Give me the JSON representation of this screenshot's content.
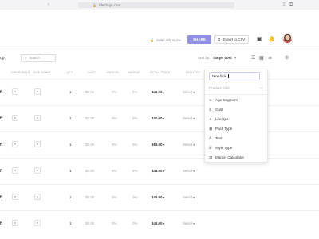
{
  "browser": {
    "url": "lifestage.com",
    "back_icon": "chevron-left-icon",
    "share_icon": "share-icon",
    "tabs_icon": "tabs-icon"
  },
  "appbar": {
    "invite_text": "Invite only to me",
    "share_label": "SHARE",
    "export_label": "Export to CSV",
    "icons": [
      "lock-icon",
      "chat-icon",
      "bell-icon"
    ],
    "colors": {
      "share_bg": "#8f8fe6"
    }
  },
  "toolbar": {
    "left_label": "op",
    "search_placeholder": "Search",
    "sort_label": "Sort by:",
    "sort_value": "Target cost",
    "view_icons": [
      "list-icon",
      "grid-icon",
      "columns-icon"
    ],
    "settings_icon": "gear-icon"
  },
  "columns": [
    "Colorways",
    "Size scale",
    "QTY",
    "Cost",
    "Margin",
    "Markup",
    "Retail price",
    "Delivery"
  ],
  "rows": [
    {
      "product": "ft",
      "qty": "1",
      "cost": "$0.00",
      "margin": "0%",
      "markup": "0%",
      "retail": "$48.00",
      "delivery": "Select"
    },
    {
      "product": "ft",
      "qty": "1",
      "cost": "$0.00",
      "margin": "0%",
      "markup": "0%",
      "retail": "$30.00",
      "delivery": "Select"
    },
    {
      "product": "ft",
      "qty": "1",
      "cost": "$0.00",
      "margin": "0%",
      "markup": "0%",
      "retail": "$68.00",
      "delivery": "Select"
    },
    {
      "product": "ft",
      "qty": "1",
      "cost": "$0.00",
      "margin": "0%",
      "markup": "0%",
      "retail": "$48.00",
      "delivery": "Select"
    },
    {
      "product": "ft",
      "qty": "1",
      "cost": "$0.00",
      "margin": "0%",
      "markup": "0%",
      "retail": "$48.00",
      "delivery": "Select"
    },
    {
      "product": "ft",
      "qty": "1",
      "cost": "$0.00",
      "margin": "0%",
      "markup": "0%",
      "retail": "$48.00",
      "delivery": "Select"
    }
  ],
  "menu": {
    "input_value": "New field",
    "product_field_label": "Product field",
    "items": [
      {
        "label": "Age Segment",
        "icon": "list-icon"
      },
      {
        "label": "Cost",
        "icon": "dollar-icon"
      },
      {
        "label": "Lifestyle",
        "icon": "star-icon"
      },
      {
        "label": "Pack Type",
        "icon": "box-icon"
      },
      {
        "label": "Text",
        "icon": "text-icon"
      },
      {
        "label": "Style Type",
        "icon": "style-icon"
      },
      {
        "label": "Margin Calculator",
        "icon": "calculator-icon"
      }
    ]
  }
}
